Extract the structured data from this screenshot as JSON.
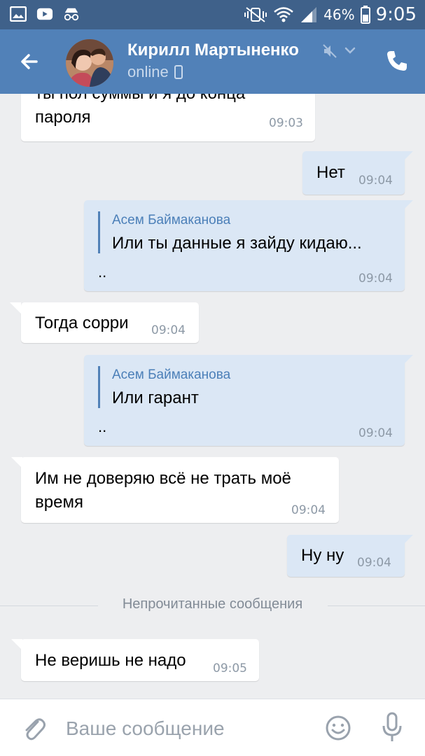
{
  "status_bar": {
    "battery_percent": "46%",
    "time": "9:05",
    "icons": [
      "gallery-icon",
      "youtube-icon",
      "incognito-icon",
      "vibrate-mute-icon",
      "wifi-icon",
      "signal-icon",
      "battery-icon"
    ]
  },
  "header": {
    "contact_name": "Кирилл Мартыненко",
    "presence": "online",
    "icons": [
      "back-arrow-icon",
      "mute-icon",
      "chevron-down-icon",
      "phone-icon"
    ]
  },
  "colors": {
    "header_bg": "#5181b8",
    "status_bg": "#3f618a",
    "chat_bg": "#edeef0",
    "outgoing_bubble": "#dbe7f5",
    "incoming_bubble": "#ffffff",
    "reply_name": "#4b7fb8"
  },
  "messages": [
    {
      "direction": "in",
      "lines": [
        "ты пол суммы и я до конца",
        "пароля"
      ],
      "time": "09:03"
    },
    {
      "direction": "out",
      "text": "Нет",
      "time": "09:04"
    },
    {
      "direction": "out",
      "reply": {
        "author": "Асем Баймаканова",
        "text": "Или ты данные я зайду кидаю..."
      },
      "text": "..",
      "time": "09:04"
    },
    {
      "direction": "in",
      "text": "Тогда сорри",
      "time": "09:04"
    },
    {
      "direction": "out",
      "reply": {
        "author": "Асем Баймаканова",
        "text": "Или гарант"
      },
      "text": "..",
      "time": "09:04"
    },
    {
      "direction": "in",
      "lines": [
        "Им не доверяю всё не трать моё",
        "время"
      ],
      "time": "09:04"
    },
    {
      "direction": "out",
      "text": "Ну ну",
      "time": "09:04"
    },
    {
      "direction": "in",
      "text": "Не веришь не надо",
      "time": "09:05"
    }
  ],
  "unread_divider": "Непрочитанные сообщения",
  "composer": {
    "placeholder": "Ваше сообщение",
    "icons": [
      "paperclip-icon",
      "emoji-icon",
      "microphone-icon"
    ]
  }
}
